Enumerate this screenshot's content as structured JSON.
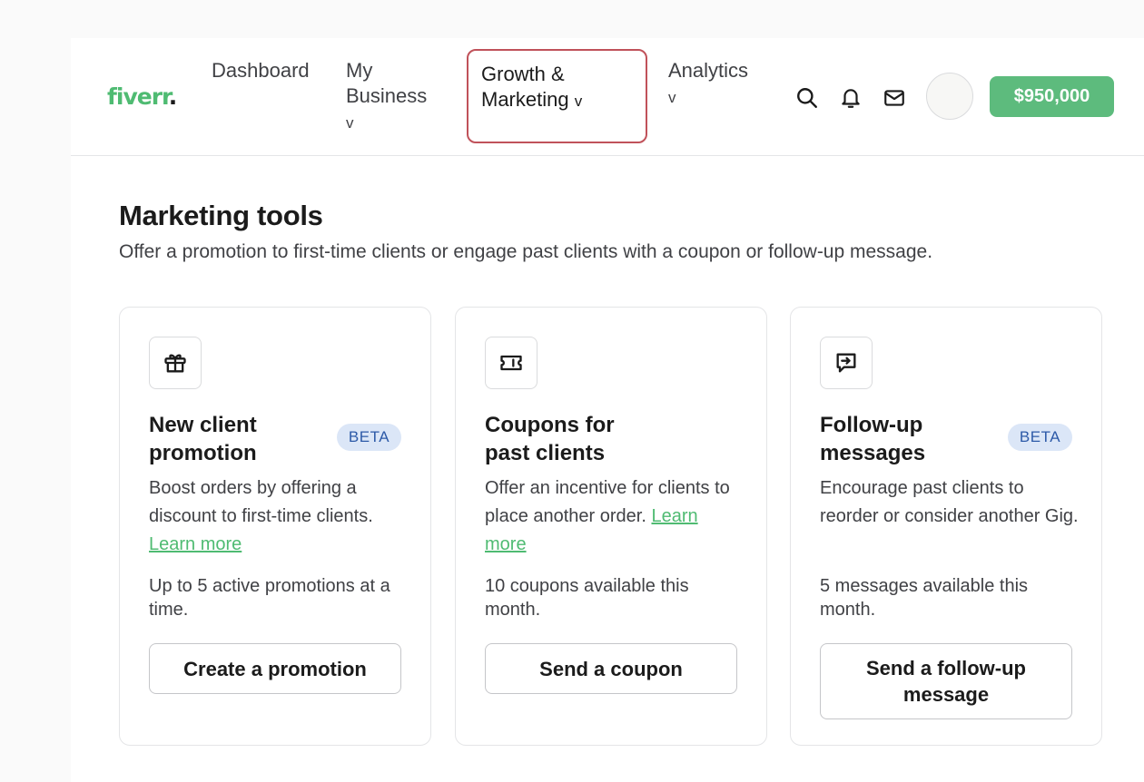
{
  "header": {
    "logo_text": "fiverr",
    "logo_dot": ".",
    "nav": {
      "dashboard": "Dashboard",
      "my_business": "My Business",
      "growth_marketing": "Growth & Marketing",
      "analytics": "Analytics",
      "chevron": "v"
    },
    "icons": [
      "search-icon",
      "bell-icon",
      "mail-icon"
    ],
    "balance": "$950,000"
  },
  "main": {
    "title": "Marketing tools",
    "subtitle": "Offer a promotion to first-time clients or engage past clients with a coupon or follow-up message.",
    "cards": [
      {
        "icon": "gift-icon",
        "title": "New client promotion",
        "badge": "BETA",
        "desc": "Boost orders by offering a discount to first-time clients.",
        "link": "Learn more",
        "limit": "Up to 5 active promotions at a time.",
        "button": "Create a promotion"
      },
      {
        "icon": "ticket-icon",
        "title": "Coupons for past clients",
        "desc": "Offer an incentive for clients to place another order.",
        "link": "Learn more",
        "limit": "10 coupons available this month.",
        "button": "Send a coupon"
      },
      {
        "icon": "message-forward-icon",
        "title": "Follow-up messages",
        "badge": "BETA",
        "desc": "Encourage past clients to reorder or consider another Gig.",
        "limit": "5 messages available this month.",
        "button": "Send a follow-up message"
      }
    ]
  },
  "colors": {
    "brand_green": "#4fbb72",
    "balance_green": "#5dbb7d",
    "highlight_border": "#c0525a",
    "beta_bg": "#dbe6f7",
    "beta_text": "#2d5aa8"
  }
}
